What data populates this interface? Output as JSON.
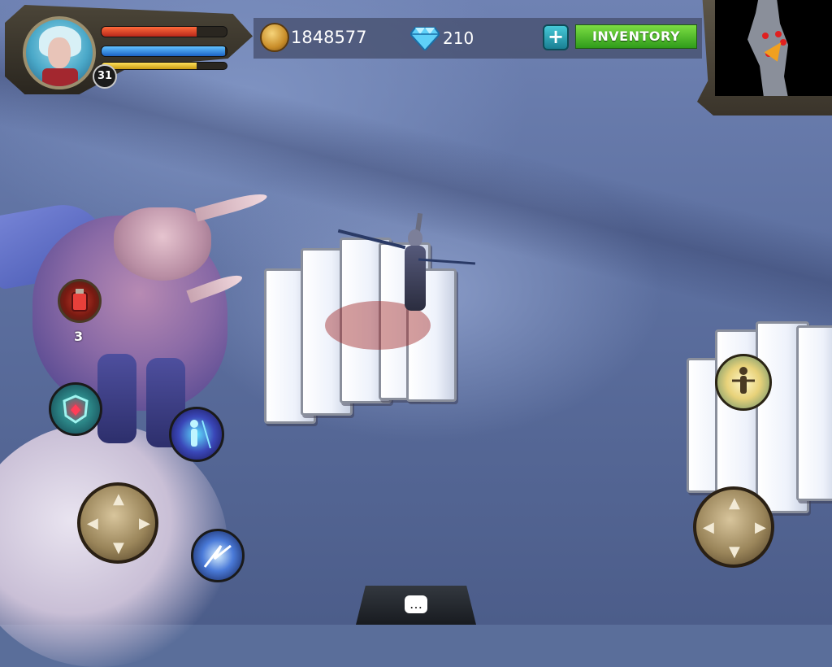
{
  "player": {
    "level": "31",
    "health_fraction": 0.76,
    "mana_fraction": 0.99,
    "xp_fraction": 0.76
  },
  "currency": {
    "gold": "1848577",
    "gems": "210"
  },
  "top_bar": {
    "add_currency_label": "+",
    "inventory_label": "INVENTORY"
  },
  "consumable": {
    "count": "3"
  },
  "chat": {
    "icon": "speech-bubble-icon",
    "glyph": "…"
  },
  "colors": {
    "health": "#d8402a",
    "mana": "#2f8de0",
    "xp": "#e6c02a",
    "inventory_button": "#4fbf2a",
    "portrait_glow": "#ff8a1a"
  },
  "icons": {
    "gold": "gold-coin-icon",
    "gems": "diamond-icon",
    "potion": "red-potion-icon",
    "skill_1": "shield-skill-icon",
    "skill_2": "teleport-skill-icon",
    "skill_3": "lightning-skill-icon",
    "skill_4": "heal-skill-icon",
    "movement_left": "dpad-icon",
    "movement_right": "dpad-icon"
  }
}
